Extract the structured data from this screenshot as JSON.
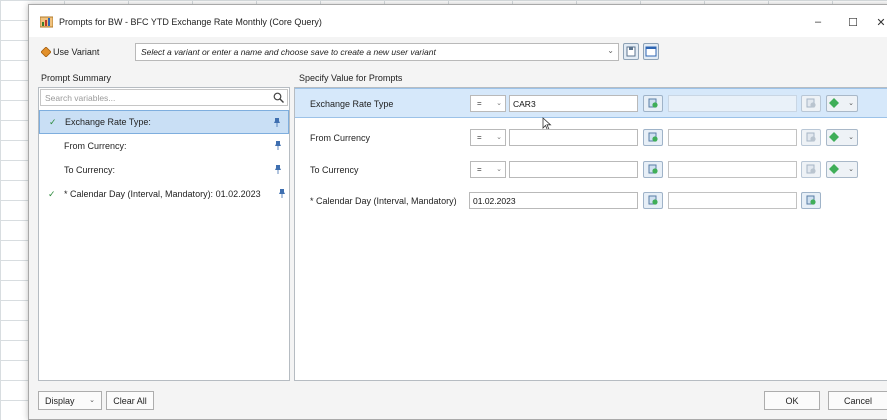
{
  "window": {
    "title": "Prompts for BW - BFC YTD Exchange Rate Monthly (Core Query)",
    "controls": {
      "minimize": "–",
      "maximize": "☐",
      "close": "✕"
    }
  },
  "variant": {
    "label": "Use Variant",
    "placeholder": "Select a variant or enter a name and choose save to create a new user variant"
  },
  "prompt_summary": {
    "heading": "Prompt Summary",
    "search_placeholder": "Search variables...",
    "items": [
      {
        "label": "Exchange Rate Type:",
        "checked": "✓"
      },
      {
        "label": "From Currency:",
        "checked": ""
      },
      {
        "label": "To Currency:",
        "checked": ""
      },
      {
        "label": "* Calendar Day (Interval, Mandatory): 01.02.2023",
        "checked": "✓"
      }
    ]
  },
  "specify": {
    "heading": "Specify Value for Prompts",
    "rows": [
      {
        "label": "Exchange Rate Type",
        "operator": "=",
        "value": "CAR3"
      },
      {
        "label": "From Currency",
        "operator": "=",
        "value": ""
      },
      {
        "label": "To Currency",
        "operator": "=",
        "value": ""
      },
      {
        "label": "* Calendar Day (Interval, Mandatory)",
        "value": "01.02.2023"
      }
    ]
  },
  "footer": {
    "display": "Display",
    "clear_all": "Clear All",
    "ok": "OK",
    "cancel": "Cancel"
  }
}
